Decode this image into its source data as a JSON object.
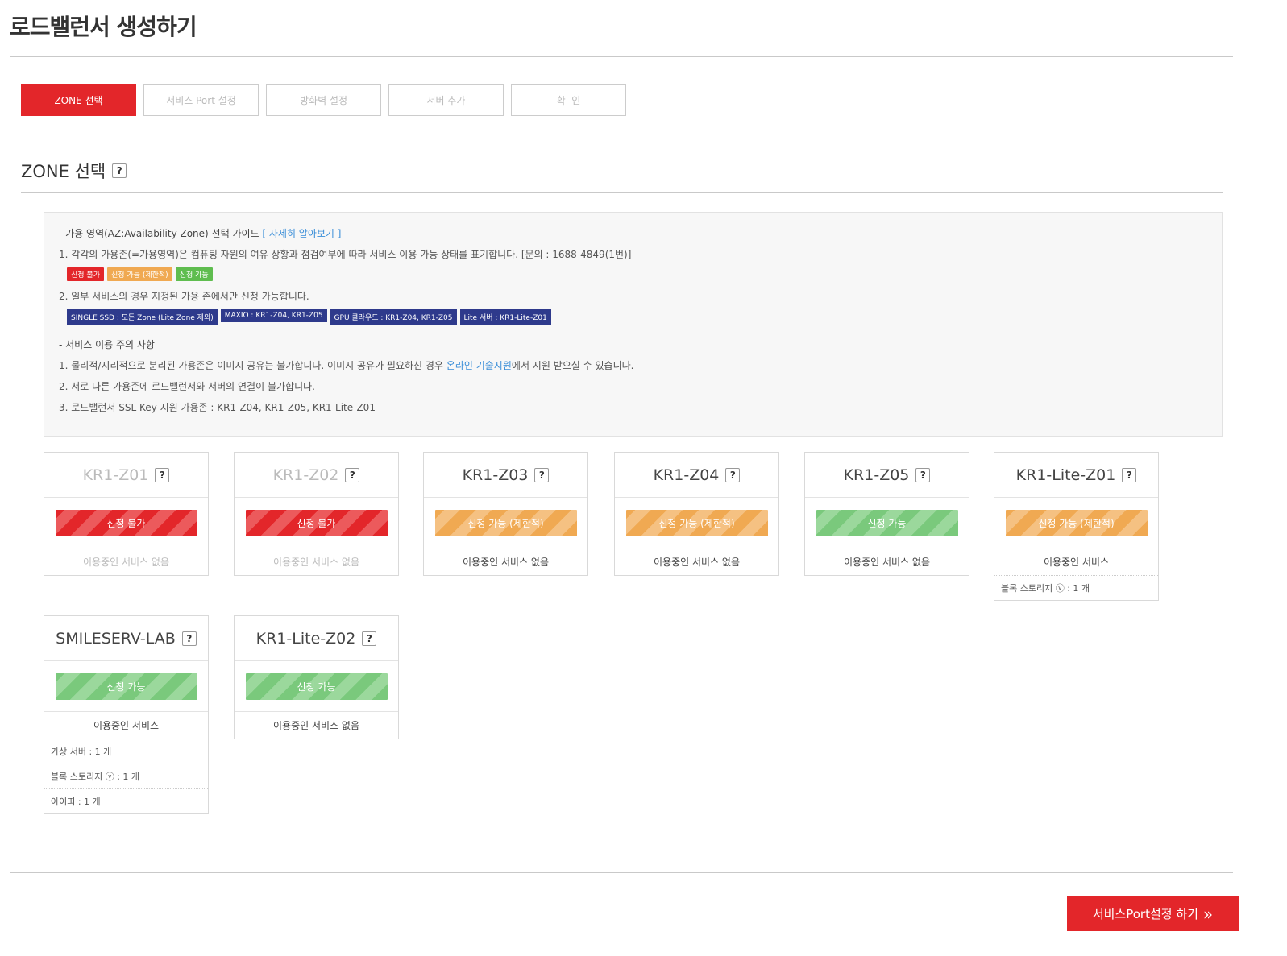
{
  "page": {
    "title": "로드밸런서 생성하기"
  },
  "steps": [
    {
      "label": "ZONE 선택"
    },
    {
      "label": "서비스 Port 설정"
    },
    {
      "label": "방화벽 설정"
    },
    {
      "label": "서버 추가"
    },
    {
      "label": "확  인"
    }
  ],
  "section": {
    "title": "ZONE 선택",
    "help": "?"
  },
  "guide": {
    "heading_prefix": "- 가용 영역(AZ:Availability Zone) 선택 가이드 ",
    "heading_link": "[ 자세히 알아보기 ]",
    "line1": "1. 각각의 가용존(=가용영역)은 컴퓨팅 자원의 여유 상황과 점검여부에 따라 서비스 이용 가능 상태를 표기합니다. [문의 : 1688-4849(1번)]",
    "legend": [
      "신청 불가",
      "신청 가능 (제한적)",
      "신청 가능"
    ],
    "line2": "2. 일부 서비스의 경우 지정된 가용 존에서만 신청 가능합니다.",
    "zones": [
      "SINGLE SSD : 모든 Zone (Lite Zone 제외)",
      "MAXIO : KR1-Z04, KR1-Z05",
      "GPU 클라우드 : KR1-Z04, KR1-Z05",
      "Lite 서버 : KR1-Lite-Z01"
    ],
    "caution_heading": "- 서비스 이용 주의 사항",
    "caution1_prefix": "1. 물리적/지리적으로 분리된 가용존은 이미지 공유는 불가합니다. 이미지 공유가 필요하신 경우 ",
    "caution1_link": "온라인 기술지원",
    "caution1_suffix": "에서 지원 받으실 수 있습니다.",
    "caution2": "2. 서로 다른 가용존에 로드밸런서와 서버의 연결이 불가합니다.",
    "caution3": "3. 로드밸런서 SSL Key 지원 가용존 : KR1-Z04, KR1-Z05, KR1-Lite-Z01"
  },
  "zones": [
    {
      "name": "KR1-Z01",
      "status": "신청 불가",
      "status_type": "red",
      "service": "이용중인 서비스 없음",
      "items": []
    },
    {
      "name": "KR1-Z02",
      "status": "신청 불가",
      "status_type": "red",
      "service": "이용중인 서비스 없음",
      "items": []
    },
    {
      "name": "KR1-Z03",
      "status": "신청 가능 (제한적)",
      "status_type": "orange",
      "service": "이용중인 서비스 없음",
      "items": []
    },
    {
      "name": "KR1-Z04",
      "status": "신청 가능 (제한적)",
      "status_type": "orange",
      "service": "이용중인 서비스 없음",
      "items": []
    },
    {
      "name": "KR1-Z05",
      "status": "신청 가능",
      "status_type": "green",
      "service": "이용중인 서비스 없음",
      "items": []
    },
    {
      "name": "KR1-Lite-Z01",
      "status": "신청 가능 (제한적)",
      "status_type": "orange",
      "service": "이용중인 서비스",
      "items": [
        "블록 스토리지 ⓥ : 1 개"
      ]
    },
    {
      "name": "SMILESERV-LAB",
      "status": "신청 가능",
      "status_type": "green",
      "service": "이용중인 서비스",
      "items": [
        "가상 서버 : 1 개",
        "블록 스토리지 ⓥ : 1 개",
        "아이피 : 1 개"
      ]
    },
    {
      "name": "KR1-Lite-Z02",
      "status": "신청 가능",
      "status_type": "green",
      "service": "이용중인 서비스 없음",
      "items": []
    }
  ],
  "next_button": {
    "label": "서비스Port설정 하기",
    "icon": "»"
  },
  "colors": {
    "accent": "#e3262a",
    "orange": "#f0a952",
    "green": "#7ac97c",
    "navy": "#2e3a8c",
    "link": "#3a8ed8"
  }
}
